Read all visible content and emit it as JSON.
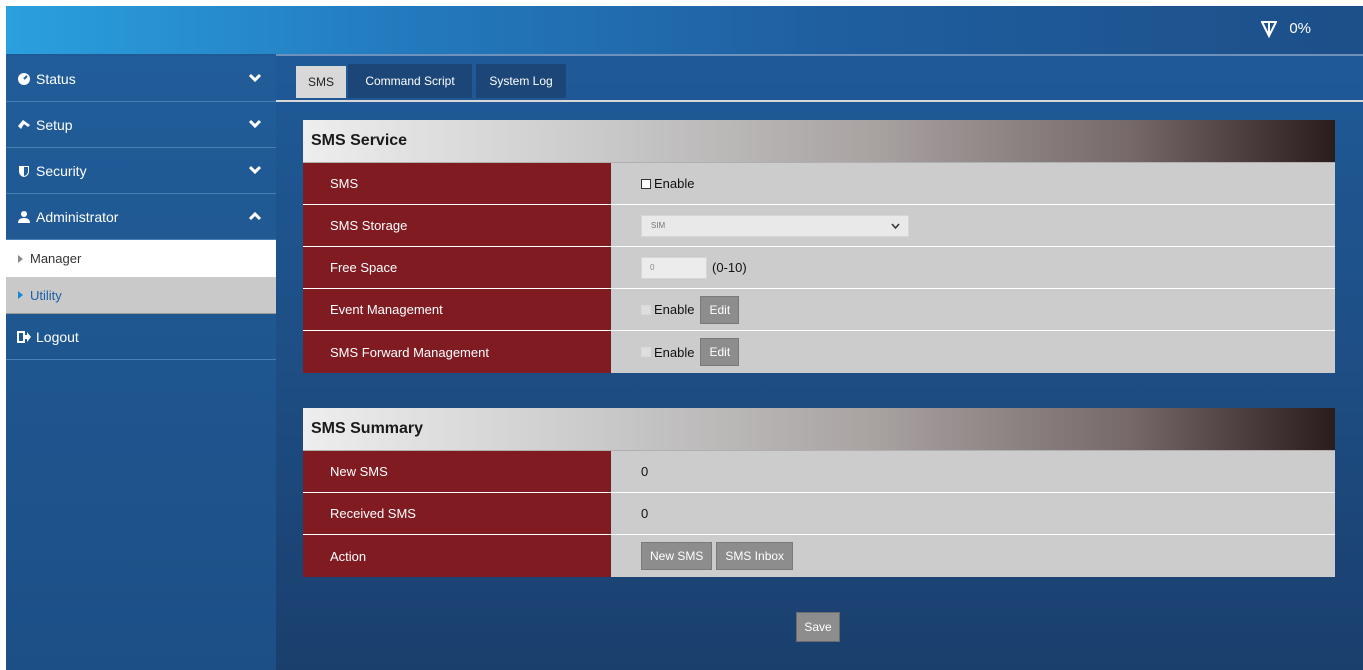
{
  "header": {
    "signal_icon": "signal-icon",
    "signal_text": "0%"
  },
  "sidebar": {
    "status": {
      "label": "Status",
      "icon": "gauge-icon"
    },
    "setup": {
      "label": "Setup",
      "icon": "wrench-icon"
    },
    "security": {
      "label": "Security",
      "icon": "shield-icon"
    },
    "administrator": {
      "label": "Administrator",
      "icon": "user-icon"
    },
    "manager": {
      "label": "Manager"
    },
    "utility": {
      "label": "Utility"
    },
    "logout": {
      "label": "Logout",
      "icon": "sign-out-icon"
    }
  },
  "tabs": {
    "sms": "SMS",
    "command_script": "Command Script",
    "system_log": "System Log"
  },
  "sms_service": {
    "title": "SMS Service",
    "rows": {
      "sms": {
        "label": "SMS",
        "checkbox_label": "Enable"
      },
      "storage": {
        "label": "SMS Storage",
        "value": "SIM"
      },
      "free_space": {
        "label": "Free Space",
        "value": "0",
        "range": "(0-10)"
      },
      "event_mgmt": {
        "label": "Event Management",
        "checkbox_label": "Enable",
        "button": "Edit"
      },
      "forward_mgmt": {
        "label": "SMS Forward Management",
        "checkbox_label": "Enable",
        "button": "Edit"
      }
    }
  },
  "sms_summary": {
    "title": "SMS Summary",
    "rows": {
      "new_sms": {
        "label": "New SMS",
        "value": "0"
      },
      "received_sms": {
        "label": "Received SMS",
        "value": "0"
      },
      "action": {
        "label": "Action",
        "new_sms_button": "New SMS",
        "inbox_button": "SMS Inbox"
      }
    }
  },
  "save_label": "Save",
  "colors": {
    "label_bg": "#801b22",
    "accent_blue": "#1f5c9a"
  }
}
